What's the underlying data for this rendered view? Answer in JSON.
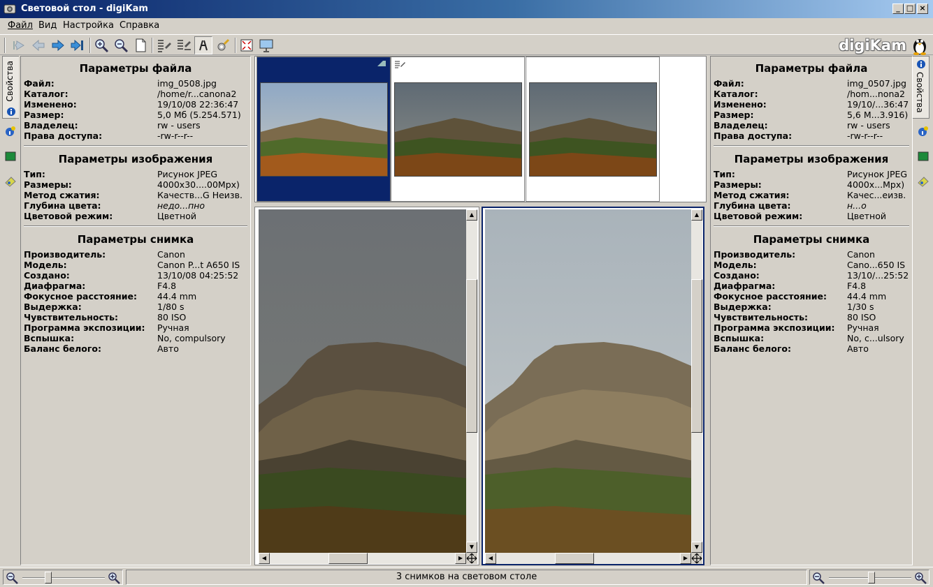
{
  "window": {
    "title": "Световой стол - digiKam",
    "min": "_",
    "max": "□",
    "close": "×"
  },
  "menu": [
    "Файл",
    "Вид",
    "Настройка",
    "Справка"
  ],
  "logo": "digiKam",
  "colors": {
    "title_start": "#0a246a",
    "title_end": "#a6caf0",
    "selection": "#0a246a",
    "face": "#d4d0c8"
  },
  "toolbar_icons": [
    "first-icon",
    "back-icon",
    "forward-icon",
    "last-icon",
    "zoom-in-icon",
    "zoom-out-icon",
    "fit-icon",
    "list-icon",
    "sync-icon",
    "navigate-icon",
    "edit-icon",
    "fullscreen-icon",
    "slideshow-icon"
  ],
  "sidetab_label": "Свойства",
  "left": {
    "file_title": "Параметры файла",
    "file": [
      {
        "k": "Файл:",
        "v": "img_0508.jpg"
      },
      {
        "k": "Каталог:",
        "v": "/home/r...canona2"
      },
      {
        "k": "Изменено:",
        "v": "19/10/08 22:36:47"
      },
      {
        "k": "Размер:",
        "v": "5,0 Мб (5.254.571)"
      },
      {
        "k": "Владелец:",
        "v": "rw - users"
      },
      {
        "k": "Права доступа:",
        "v": "-rw-r--r--"
      }
    ],
    "image_title": "Параметры изображения",
    "image": [
      {
        "k": "Тип:",
        "v": "Рисунок JPEG"
      },
      {
        "k": "Размеры:",
        "v": "4000x30....00Mpx)"
      },
      {
        "k": "Метод сжатия:",
        "v": "Качеств...G Неизв."
      },
      {
        "k": "Глубина цвета:",
        "v": "недо...пно"
      },
      {
        "k": "Цветовой режим:",
        "v": "Цветной"
      }
    ],
    "shot_title": "Параметры снимка",
    "shot": [
      {
        "k": "Производитель:",
        "v": "Canon"
      },
      {
        "k": "Модель:",
        "v": "Canon P...t A650 IS"
      },
      {
        "k": "Создано:",
        "v": "13/10/08 04:25:52"
      },
      {
        "k": "Диафрагма:",
        "v": "F4.8"
      },
      {
        "k": "Фокусное расстояние:",
        "v": "44.4 mm"
      },
      {
        "k": "Выдержка:",
        "v": "1/80 s"
      },
      {
        "k": "Чувствительность:",
        "v": "80 ISO"
      },
      {
        "k": "Программа экспозиции:",
        "v": "Ручная"
      },
      {
        "k": "Вспышка:",
        "v": "No, compulsory"
      },
      {
        "k": "Баланс белого:",
        "v": "Авто"
      }
    ]
  },
  "right": {
    "file_title": "Параметры файла",
    "file": [
      {
        "k": "Файл:",
        "v": "img_0507.jpg"
      },
      {
        "k": "Каталог:",
        "v": "/hom...nona2"
      },
      {
        "k": "Изменено:",
        "v": "19/10/...36:47"
      },
      {
        "k": "Размер:",
        "v": "5,6 М...3.916)"
      },
      {
        "k": "Владелец:",
        "v": "rw - users"
      },
      {
        "k": "Права доступа:",
        "v": "-rw-r--r--"
      }
    ],
    "image_title": "Параметры изображения",
    "image": [
      {
        "k": "Тип:",
        "v": "Рисунок JPEG"
      },
      {
        "k": "Размеры:",
        "v": "4000x...Mpx)"
      },
      {
        "k": "Метод сжатия:",
        "v": "Качес...еизв."
      },
      {
        "k": "Глубина цвета:",
        "v": "н...о"
      },
      {
        "k": "Цветовой режим:",
        "v": "Цветной"
      }
    ],
    "shot_title": "Параметры снимка",
    "shot": [
      {
        "k": "Производитель:",
        "v": "Canon"
      },
      {
        "k": "Модель:",
        "v": "Cano...650 IS"
      },
      {
        "k": "Создано:",
        "v": "13/10/...25:52"
      },
      {
        "k": "Диафрагма:",
        "v": "F4.8"
      },
      {
        "k": "Фокусное расстояние:",
        "v": "44.4 mm"
      },
      {
        "k": "Выдержка:",
        "v": "1/30 s"
      },
      {
        "k": "Чувствительность:",
        "v": "80 ISO"
      },
      {
        "k": "Программа экспозиции:",
        "v": "Ручная"
      },
      {
        "k": "Вспышка:",
        "v": "No, c...ulsory"
      },
      {
        "k": "Баланс белого:",
        "v": "Авто"
      }
    ]
  },
  "status": "3 снимков на световом столе",
  "zoom_left": 0.3,
  "zoom_right": 0.52
}
